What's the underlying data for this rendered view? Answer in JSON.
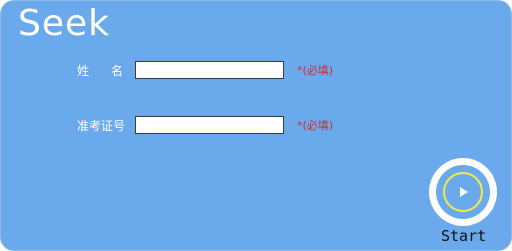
{
  "app": {
    "title": "Seek"
  },
  "form": {
    "name_label": "姓名",
    "exam_id_label": "准考证号",
    "name_value": "",
    "exam_id_value": "",
    "required_hint": "*(必填)"
  },
  "start": {
    "label": "Start",
    "icon": "play-icon"
  },
  "colors": {
    "background": "#6aa9ec",
    "required": "#e0262a",
    "ring": "#f2e84a"
  }
}
